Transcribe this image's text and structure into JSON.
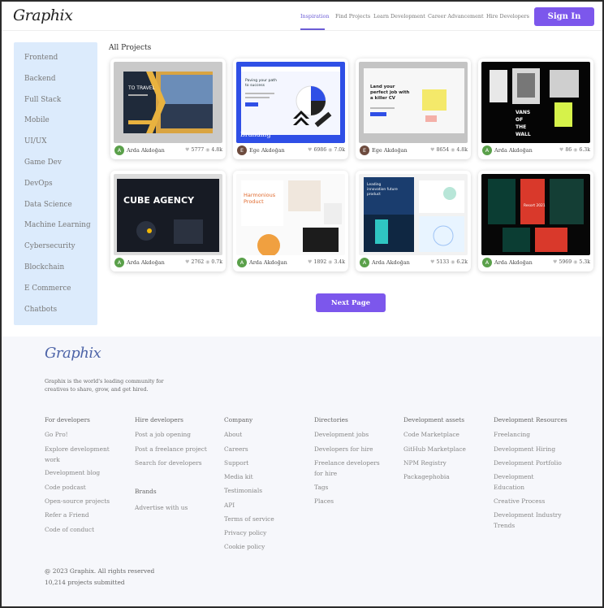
{
  "header": {
    "logo": "Graphix",
    "nav": [
      {
        "label": "Inspiration",
        "active": true
      },
      {
        "label": "Find Projects",
        "active": false
      },
      {
        "label": "Learn Development",
        "active": false
      },
      {
        "label": "Career Advancement",
        "active": false
      },
      {
        "label": "Hire Developers",
        "active": false
      }
    ],
    "signin_label": "Sign In",
    "accent_color": "#7c57ec"
  },
  "sidebar": {
    "items": [
      "Frontend",
      "Backend",
      "Full Stack",
      "Mobile",
      "UI/UX",
      "Game Dev",
      "DevOps",
      "Data Science",
      "Machine Learning",
      "Cybersecurity",
      "Blockchain",
      "E Commerce",
      "Chatbots"
    ]
  },
  "main": {
    "title": "All Projects",
    "projects": [
      {
        "author": "Arda Akdoğan",
        "initial": "A",
        "avatar_color": "#5aa04a",
        "likes": "5777",
        "views": "4.8k",
        "label": ""
      },
      {
        "author": "Ege Akdoğan",
        "initial": "E",
        "avatar_color": "#6d4b3e",
        "likes": "6986",
        "views": "7.0k",
        "label": "Branding"
      },
      {
        "author": "Ege Akdoğan",
        "initial": "E",
        "avatar_color": "#6d4b3e",
        "likes": "8654",
        "views": "4.8k",
        "label": ""
      },
      {
        "author": "Arda Akdoğan",
        "initial": "A",
        "avatar_color": "#5aa04a",
        "likes": "86",
        "views": "6.3k",
        "label": ""
      },
      {
        "author": "Arda Akdoğan",
        "initial": "A",
        "avatar_color": "#5aa04a",
        "likes": "2762",
        "views": "0.7k",
        "label": ""
      },
      {
        "author": "Arda Akdoğan",
        "initial": "A",
        "avatar_color": "#5aa04a",
        "likes": "1892",
        "views": "3.4k",
        "label": ""
      },
      {
        "author": "Arda Akdoğan",
        "initial": "A",
        "avatar_color": "#5aa04a",
        "likes": "5133",
        "views": "6.2k",
        "label": ""
      },
      {
        "author": "Arda Akdoğan",
        "initial": "A",
        "avatar_color": "#5aa04a",
        "likes": "5969",
        "views": "5.3k",
        "label": ""
      }
    ],
    "thumb_texts": {
      "t1_a": "TO TRAVEL",
      "t2_a": "Paving your path",
      "t2_b": "to success",
      "t3_a": "Land your",
      "t3_b": "perfect job with",
      "t3_c": "a killer CV",
      "t4_a": "VANS",
      "t4_b": "OF",
      "t4_c": "THE",
      "t4_d": "WALL",
      "t5_a": "CUBE AGENCY",
      "t6_a": "Harmonious",
      "t6_b": "Product",
      "t7_a": "Leading",
      "t7_b": "innovation future",
      "t7_c": "product",
      "t8_a": "Resort 2021"
    },
    "next_label": "Next Page"
  },
  "footer": {
    "logo": "Graphix",
    "tagline": "Graphix is the world's leading community for creatives to share, grow, and get hired.",
    "columns": [
      {
        "heading": "For developers",
        "links": [
          "Go Pro!",
          "Explore development work",
          "Development blog",
          "Code podcast",
          "Open-source projects",
          "Refer a Friend",
          "Code of conduct"
        ]
      },
      {
        "heading": "Hire developers",
        "links": [
          "Post a job opening",
          "Post a freelance project",
          "Search for developers"
        ],
        "heading2": "Brands",
        "links2": [
          "Advertise with us"
        ]
      },
      {
        "heading": "Company",
        "links": [
          "About",
          "Careers",
          "Support",
          "Media kit",
          "Testimonials",
          "API",
          "Terms of service",
          "Privacy policy",
          "Cookie policy"
        ]
      },
      {
        "heading": "Directories",
        "links": [
          "Development jobs",
          "Developers for hire",
          "Freelance developers for hire",
          "Tags",
          "Places"
        ]
      },
      {
        "heading": "Development assets",
        "links": [
          "Code Marketplace",
          "GitHub Marketplace",
          "NPM Registry",
          "Packagephobia"
        ]
      },
      {
        "heading": "Development Resources",
        "links": [
          "Freelancing",
          "Development Hiring",
          "Development Portfolio",
          "Development Education",
          "Creative Process",
          "Development Industry Trends"
        ]
      }
    ],
    "copyright": "@ 2023 Graphix. All rights reserved",
    "projects_count": "10,214",
    "projects_suffix": "projects submitted"
  }
}
